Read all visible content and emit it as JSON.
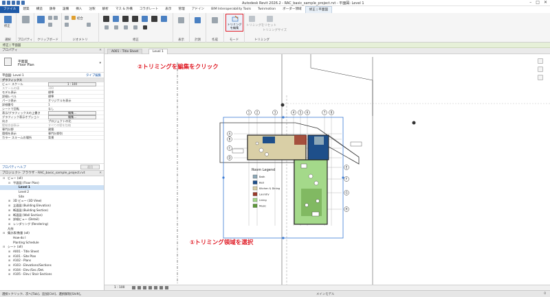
{
  "window": {
    "title": "Autodesk Revit 2026.2 - RAC_basic_sample_project.rvt - 平面図: Level 1"
  },
  "ribbon_tabs": [
    {
      "label": "ファイル"
    },
    {
      "label": "建築"
    },
    {
      "label": "構造"
    },
    {
      "label": "鉄骨"
    },
    {
      "label": "設備"
    },
    {
      "label": "挿入"
    },
    {
      "label": "注釈"
    },
    {
      "label": "解析"
    },
    {
      "label": "マス & 外構"
    },
    {
      "label": "コラボレート"
    },
    {
      "label": "表示"
    },
    {
      "label": "管理"
    },
    {
      "label": "アドイン"
    },
    {
      "label": "BIM Interoperability Tools"
    },
    {
      "label": "Twinmotion"
    },
    {
      "label": "ボーダー領域"
    },
    {
      "label": "修正 | 平面図"
    }
  ],
  "ribbon_groups": [
    {
      "label": "選択"
    },
    {
      "label": "プロパティ"
    },
    {
      "label": "クリップボード"
    },
    {
      "label": "ジオメトリ"
    },
    {
      "label": "修正"
    },
    {
      "label": "表示"
    },
    {
      "label": "計測"
    },
    {
      "label": "作成"
    },
    {
      "label": "モード"
    },
    {
      "label": "トリミング"
    }
  ],
  "ribbon_buttons": {
    "modify": "修正",
    "select_small": "選択",
    "properties_small": "プロパティ",
    "join": "結合",
    "trim_edit": "トリミングを編集",
    "trim_reset": "トリミングをリセット",
    "trim_size": "トリミングサイズ"
  },
  "context_bar": "修正 | 平面図",
  "properties": {
    "header": "プロパティ",
    "type_line1": "平面図",
    "type_line2": "Floor Plan",
    "filter": "平面図: Level 1",
    "edit_type": "タイプ編集",
    "category": "グラフィックス",
    "rows": [
      {
        "k": "ビュー スケール",
        "v": "1 : 100",
        "box": true
      },
      {
        "k": "スケールの値",
        "v": "100",
        "dim": true
      },
      {
        "k": "モデル表示",
        "v": "標準"
      },
      {
        "k": "詳細レベル",
        "v": "標準"
      },
      {
        "k": "パーツ表示",
        "v": "オリジナルを表示"
      },
      {
        "k": "詳細番号",
        "v": "1"
      },
      {
        "k": "シートで回転",
        "v": "なし"
      },
      {
        "k": "表示/グラフィックスの上書き",
        "v": "編集...",
        "box": true
      },
      {
        "k": "グラフィック表示オプション",
        "v": "編集...",
        "box": true
      },
      {
        "k": "向き",
        "v": "プロジェクトの北"
      },
      {
        "k": "壁結合部表示",
        "v": "すべての壁を包絡",
        "dim": true
      },
      {
        "k": "専門分野",
        "v": "建築"
      },
      {
        "k": "隠線を表示",
        "v": "専門分野別"
      },
      {
        "k": "カラー スキームの場所",
        "v": "背景"
      }
    ],
    "help_link": "プロパティヘルプ",
    "apply": "適用"
  },
  "browser": {
    "header": "プロジェクト ブラウザ - RAC_basic_sample_project.rvt",
    "items": [
      {
        "label": "ビュー (all)",
        "level": 0,
        "exp": "−"
      },
      {
        "label": "平面図 (Floor Plan)",
        "level": 1,
        "exp": "−"
      },
      {
        "label": "Level 1",
        "level": 2,
        "bold": true
      },
      {
        "label": "Level 2",
        "level": 2
      },
      {
        "label": "Site",
        "level": 2
      },
      {
        "label": "3D ビュー (3D View)",
        "level": 1,
        "exp": "+"
      },
      {
        "label": "立面図 (Building Elevation)",
        "level": 1,
        "exp": "+"
      },
      {
        "label": "断面図 (Building Section)",
        "level": 1,
        "exp": "+"
      },
      {
        "label": "断面図 (Wall Section)",
        "level": 1,
        "exp": "+"
      },
      {
        "label": "詳細ビュー (Detail)",
        "level": 1,
        "exp": "+"
      },
      {
        "label": "レンダリング (Rendering)",
        "level": 1,
        "exp": "+"
      },
      {
        "label": "凡例",
        "level": 0
      },
      {
        "label": "集計表/数量 (all)",
        "level": 0,
        "exp": "−"
      },
      {
        "label": "How-do I",
        "level": 1
      },
      {
        "label": "Planting Schedule",
        "level": 1
      },
      {
        "label": "シート (all)",
        "level": 0,
        "exp": "−"
      },
      {
        "label": "A001 - Title Sheet",
        "level": 1,
        "exp": "+"
      },
      {
        "label": "A101 - Site Plan",
        "level": 1,
        "exp": "+"
      },
      {
        "label": "A102 - Plans",
        "level": 1,
        "exp": "+"
      },
      {
        "label": "A103 - Elevations/Sections",
        "level": 1,
        "exp": "+"
      },
      {
        "label": "A104 - Elev./Sec./Det.",
        "level": 1,
        "exp": "+"
      },
      {
        "label": "A105 - Elev./ Stair Sections",
        "level": 1,
        "exp": "+"
      }
    ]
  },
  "view_tabs": [
    {
      "label": "A001 - Title Sheet",
      "active": false
    },
    {
      "label": "Level 1",
      "active": true
    }
  ],
  "grid_labels": [
    "1",
    "2",
    "3",
    "4",
    "5",
    "6",
    "7",
    "8",
    "A",
    "B",
    "C",
    "D",
    "E",
    "F",
    "G",
    "H"
  ],
  "legend": {
    "title": "Room Legend",
    "items": [
      {
        "label": "Bath",
        "color": "#8fa9b8"
      },
      {
        "label": "Bed",
        "color": "#1e4f8a"
      },
      {
        "label": "Kitchen & Dining",
        "color": "#d9cfa6"
      },
      {
        "label": "Laundry",
        "color": "#9b3a2a"
      },
      {
        "label": "Living",
        "color": "#a4d98a"
      },
      {
        "label": "Music",
        "color": "#5e9a3a"
      }
    ]
  },
  "annotations": {
    "step2": "②トリミングを編集をクリック",
    "step1": "①トリミング領域を選択"
  },
  "view_control": {
    "scale": "1 : 100"
  },
  "status": {
    "message": "選択+クリック、次へ[Tab]、追加[Ctrl]、選択解除[Shift]。",
    "model": "メインモデル",
    "filter": "0"
  }
}
